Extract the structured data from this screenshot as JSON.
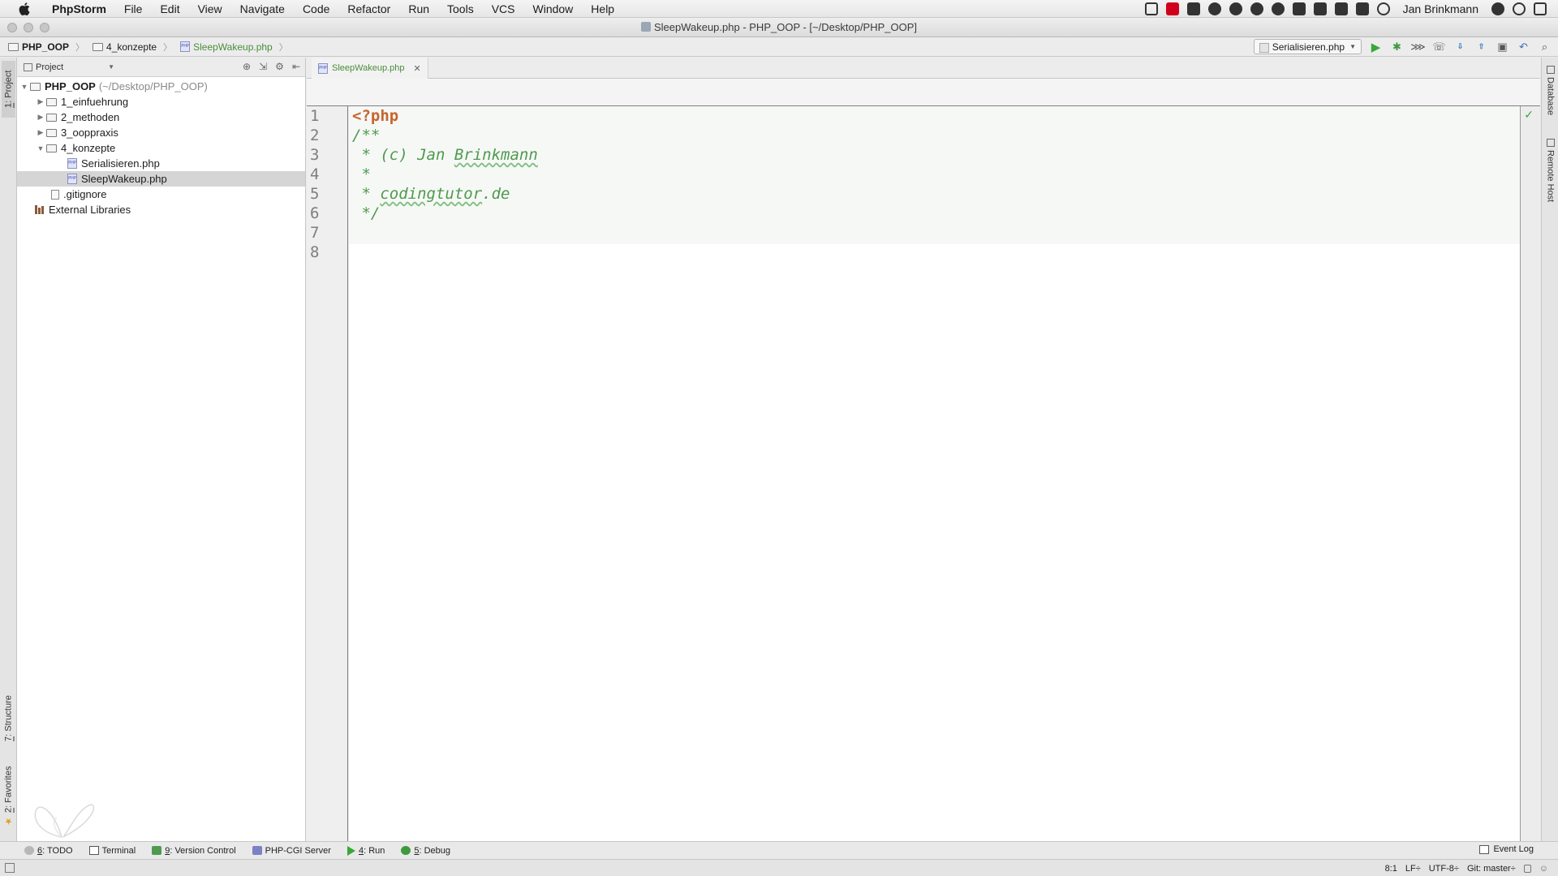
{
  "menubar": {
    "app": "PhpStorm",
    "items": [
      "File",
      "Edit",
      "View",
      "Navigate",
      "Code",
      "Refactor",
      "Run",
      "Tools",
      "VCS",
      "Window",
      "Help"
    ],
    "user": "Jan Brinkmann"
  },
  "window": {
    "title": "SleepWakeup.php - PHP_OOP - [~/Desktop/PHP_OOP]"
  },
  "breadcrumb": {
    "project": "PHP_OOP",
    "folder": "4_konzepte",
    "file": "SleepWakeup.php"
  },
  "run_config": {
    "label": "Serialisieren.php"
  },
  "project_panel": {
    "dropdown": "Project",
    "root": {
      "name": "PHP_OOP",
      "path": "(~/Desktop/PHP_OOP)"
    },
    "folders": [
      "1_einfuehrung",
      "2_methoden",
      "3_ooppraxis",
      "4_konzepte"
    ],
    "files": [
      "Serialisieren.php",
      "SleepWakeup.php"
    ],
    "gitignore": ".gitignore",
    "libraries": "External Libraries"
  },
  "editor": {
    "tab": "SleepWakeup.php",
    "line_numbers": [
      "1",
      "2",
      "3",
      "4",
      "5",
      "6",
      "7",
      "8"
    ],
    "lines": {
      "l1": "<?php",
      "l2": "/**",
      "l3_prefix": " * (c) Jan ",
      "l3_word": "Brinkmann",
      "l4": " *",
      "l5_prefix": " * ",
      "l5_word": "codingtutor",
      "l5_suffix": ".de",
      "l6": " */"
    }
  },
  "left_strip": {
    "project_tab_num": "1",
    "project_tab": ": Project",
    "structure_tab_num": "7",
    "structure_tab": ": Structure",
    "favorites_tab_num": "2",
    "favorites_tab": ": Favorites"
  },
  "right_strip": {
    "database": "Database",
    "remote_host": "Remote Host"
  },
  "bottom_tools": {
    "todo_num": "6",
    "todo": ": TODO",
    "terminal": "Terminal",
    "vc_num": "9",
    "vc": ": Version Control",
    "phpcgi": "PHP-CGI Server",
    "run_num": "4",
    "run": ": Run",
    "debug_num": "5",
    "debug": ": Debug",
    "event_log": "Event Log"
  },
  "status": {
    "position": "8:1",
    "line_sep": "LF÷",
    "encoding": "UTF-8÷",
    "vcs": "Git: master÷"
  },
  "colors": {
    "keyword": "#c8652e",
    "comment": "#4e9a4e",
    "run_green": "#38a838"
  }
}
